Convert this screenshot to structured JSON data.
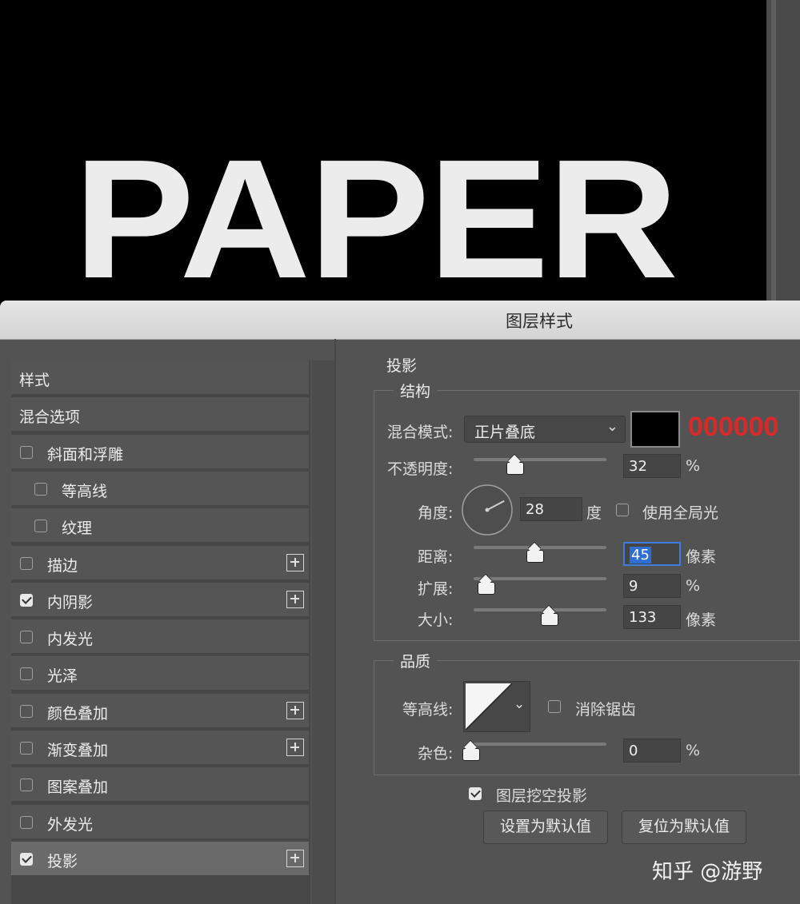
{
  "canvas": {
    "text": "PAPER"
  },
  "dialog": {
    "title": "图层样式",
    "list": [
      {
        "label": "样式",
        "checkbox": false
      },
      {
        "label": "混合选项",
        "checkbox": false
      },
      {
        "label": "斜面和浮雕",
        "checkbox": true,
        "checked": false
      },
      {
        "label": "等高线",
        "checkbox": true,
        "checked": false,
        "indent": true
      },
      {
        "label": "纹理",
        "checkbox": true,
        "checked": false,
        "indent": true
      },
      {
        "label": "描边",
        "checkbox": true,
        "checked": false,
        "add": true
      },
      {
        "label": "内阴影",
        "checkbox": true,
        "checked": true,
        "add": true
      },
      {
        "label": "内发光",
        "checkbox": true,
        "checked": false
      },
      {
        "label": "光泽",
        "checkbox": true,
        "checked": false
      },
      {
        "label": "颜色叠加",
        "checkbox": true,
        "checked": false,
        "add": true
      },
      {
        "label": "渐变叠加",
        "checkbox": true,
        "checked": false,
        "add": true
      },
      {
        "label": "图案叠加",
        "checkbox": true,
        "checked": false
      },
      {
        "label": "外发光",
        "checkbox": true,
        "checked": false
      },
      {
        "label": "投影",
        "checkbox": true,
        "checked": true,
        "add": true,
        "selected": true
      }
    ],
    "panel": {
      "section": "投影",
      "structure": {
        "legend": "结构",
        "blend_mode_label": "混合模式:",
        "blend_mode_value": "正片叠底",
        "color_swatch": "#000000",
        "color_note": "000000",
        "opacity_label": "不透明度:",
        "opacity_value": "32",
        "opacity_fraction": 0.32,
        "percent": "%",
        "angle_label": "角度:",
        "angle_value": "28",
        "angle_unit": "度",
        "global_light_label": "使用全局光",
        "distance_label": "距离:",
        "distance_value": "45",
        "pixels": "像素",
        "spread_label": "扩展:",
        "spread_value": "9",
        "spread_fraction": 0.09,
        "size_label": "大小:",
        "size_value": "133"
      },
      "quality": {
        "legend": "品质",
        "contour_label": "等高线:",
        "antialias_label": "消除锯齿",
        "noise_label": "杂色:",
        "noise_value": "0",
        "noise_fraction": 0,
        "percent": "%"
      },
      "knockout_label": "图层挖空投影",
      "default_button": "设置为默认值",
      "reset_button": "复位为默认值"
    }
  },
  "watermark": "知乎 @游野",
  "colors": {
    "accent_red": "#d92a2a",
    "selection_blue": "#2d6fd2"
  }
}
